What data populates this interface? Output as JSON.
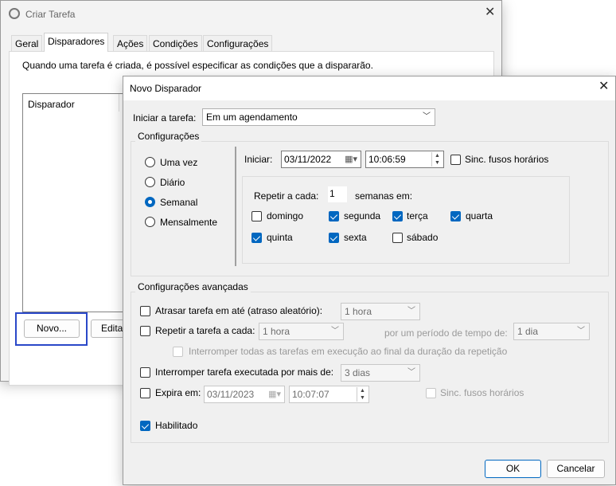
{
  "parent_window": {
    "title": "Criar Tarefa",
    "tabs": [
      "Geral",
      "Disparadores",
      "Ações",
      "Condições",
      "Configurações"
    ],
    "active_tab": "Disparadores",
    "description": "Quando uma tarefa é criada, é possível especificar as condições que a dispararão.",
    "list_header": "Disparador",
    "new_button": "Novo...",
    "edit_button": "Editar",
    "icon": "clock-icon"
  },
  "dialog": {
    "title": "Novo Disparador",
    "start_task_label": "Iniciar a tarefa:",
    "start_task_value": "Em um agendamento",
    "settings_group": "Configurações",
    "schedule_options": [
      {
        "label": "Uma vez",
        "selected": false
      },
      {
        "label": "Diário",
        "selected": false
      },
      {
        "label": "Semanal",
        "selected": true
      },
      {
        "label": "Mensalmente",
        "selected": false
      }
    ],
    "start_label": "Iniciar:",
    "start_date": "03/11/2022",
    "start_time": "10:06:59",
    "sync_timezones_label": "Sinc. fusos horários",
    "sync_timezones": false,
    "repeat_every_label": "Repetir a cada:",
    "repeat_every_value": "1",
    "weeks_on_label": "semanas em:",
    "days": [
      {
        "label": "domingo",
        "checked": false
      },
      {
        "label": "segunda",
        "checked": true
      },
      {
        "label": "terça",
        "checked": true
      },
      {
        "label": "quarta",
        "checked": true
      },
      {
        "label": "quinta",
        "checked": true
      },
      {
        "label": "sexta",
        "checked": true
      },
      {
        "label": "sábado",
        "checked": false
      }
    ],
    "advanced_group": "Configurações avançadas",
    "delay_label": "Atrasar tarefa em até (atraso aleatório):",
    "delay_value": "1 hora",
    "repeat_task_label": "Repetir a tarefa a cada:",
    "repeat_task_value": "1 hora",
    "duration_label": "por um período de tempo de:",
    "duration_value": "1 dia",
    "stop_all_label": "Interromper todas as tarefas em execução ao final da duração da repetição",
    "stop_longer_label": "Interromper tarefa executada por mais de:",
    "stop_longer_value": "3 dias",
    "expire_label": "Expira em:",
    "expire_date": "03/11/2023",
    "expire_time": "10:07:07",
    "expire_sync_label": "Sinc. fusos horários",
    "enabled_label": "Habilitado",
    "enabled": true,
    "ok_button": "OK",
    "cancel_button": "Cancelar"
  },
  "colors": {
    "accent": "#0067c0",
    "highlight": "#2a48c8"
  }
}
